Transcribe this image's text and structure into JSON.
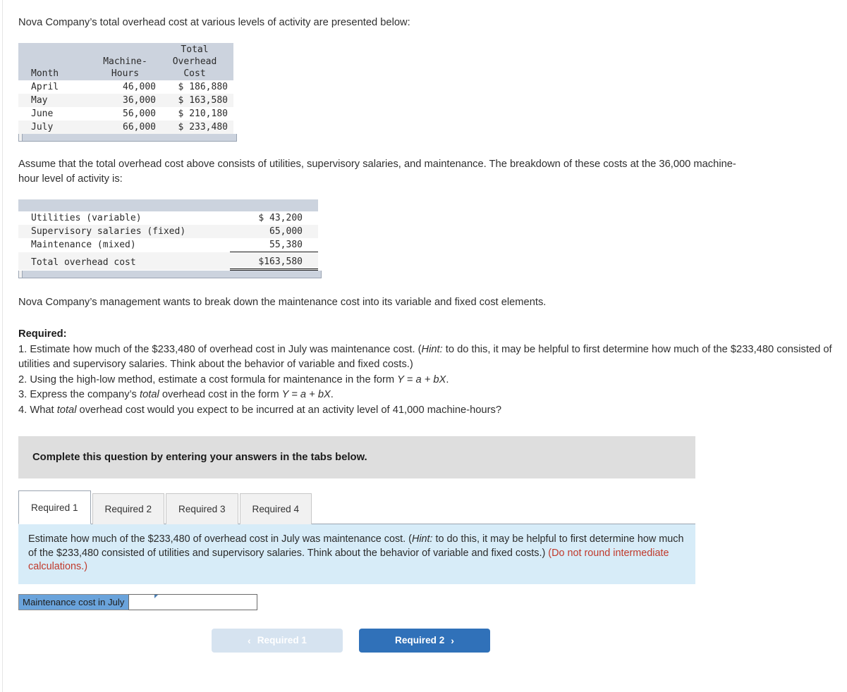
{
  "intro": "Nova Company’s total overhead cost at various levels of activity are presented below:",
  "table1": {
    "headers": {
      "col1_line1": "",
      "col1_line2": "",
      "col1_line3": "Month",
      "col2_line1": "",
      "col2_line2": "Machine-",
      "col2_line3": "Hours",
      "col3_line1": "Total",
      "col3_line2": "Overhead",
      "col3_line3": "Cost"
    },
    "rows": [
      {
        "month": "April",
        "machine_hours": "46,000",
        "total_overhead_cost": "$ 186,880"
      },
      {
        "month": "May",
        "machine_hours": "36,000",
        "total_overhead_cost": "$ 163,580"
      },
      {
        "month": "June",
        "machine_hours": "56,000",
        "total_overhead_cost": "$ 210,180"
      },
      {
        "month": "July",
        "machine_hours": "66,000",
        "total_overhead_cost": "$ 233,480"
      }
    ]
  },
  "assume_paragraph": "Assume that the total overhead cost above consists of utilities, supervisory salaries, and maintenance. The breakdown of these costs at the 36,000 machine-hour level of activity is:",
  "table2": {
    "rows": [
      {
        "label": "Utilities (variable)",
        "amount": "$ 43,200"
      },
      {
        "label": "Supervisory salaries (fixed)",
        "amount": "65,000"
      },
      {
        "label": "Maintenance (mixed)",
        "amount": "55,380"
      }
    ],
    "total": {
      "label": "Total overhead cost",
      "amount": "$163,580"
    }
  },
  "management_paragraph": "Nova Company’s management wants to break down the maintenance cost into its variable and fixed cost elements.",
  "required": {
    "title": "Required:",
    "item1_a": "1. Estimate how much of the $233,480 of overhead cost in July was maintenance cost. (",
    "item1_hint": "Hint:",
    "item1_b": " to do this, it may be helpful to first determine how much of the $233,480 consisted of utilities and supervisory salaries. Think about the behavior of variable and fixed costs.)",
    "item2_a": "2. Using the high-low method, estimate a cost formula for maintenance in the form ",
    "item2_formula": "Y = a + bX",
    "item2_b": ".",
    "item3_a": "3. Express the company’s ",
    "item3_total": "total",
    "item3_b": " overhead cost in the form ",
    "item3_formula": "Y = a + bX",
    "item3_c": ".",
    "item4_a": "4. What ",
    "item4_total": "total",
    "item4_b": " overhead cost would you expect to be incurred at an activity level of 41,000 machine-hours?"
  },
  "banner": {
    "text": "Complete this question by entering your answers in the tabs below."
  },
  "tabs": [
    {
      "label": "Required 1",
      "active": true
    },
    {
      "label": "Required 2",
      "active": false
    },
    {
      "label": "Required 3",
      "active": false
    },
    {
      "label": "Required 4",
      "active": false
    }
  ],
  "hint_box": {
    "part_a": "Estimate how much of the $233,480 of overhead cost in July was maintenance cost. (",
    "hint_word": "Hint:",
    "part_b": " to do this, it may be helpful to first determine how much of the $233,480 consisted of utilities and supervisory salaries. Think about the behavior of variable and fixed costs.) ",
    "note": "(Do not round intermediate calculations.)"
  },
  "answer_row": {
    "label": "Maintenance cost in July",
    "value": "",
    "placeholder": ""
  },
  "nav": {
    "prev_label": "Required 1",
    "prev_chevron": "‹",
    "next_label": "Required 2",
    "next_chevron": "›"
  },
  "colors": {
    "table_header": "#ccd3de",
    "banner_gray": "#dedede",
    "hint_blue": "#d7ecf8",
    "note_red": "#c0392b",
    "answer_label_blue": "#6aa3db",
    "btn_next_blue": "#3071b9",
    "btn_prev_blue": "#d6e3f0"
  }
}
